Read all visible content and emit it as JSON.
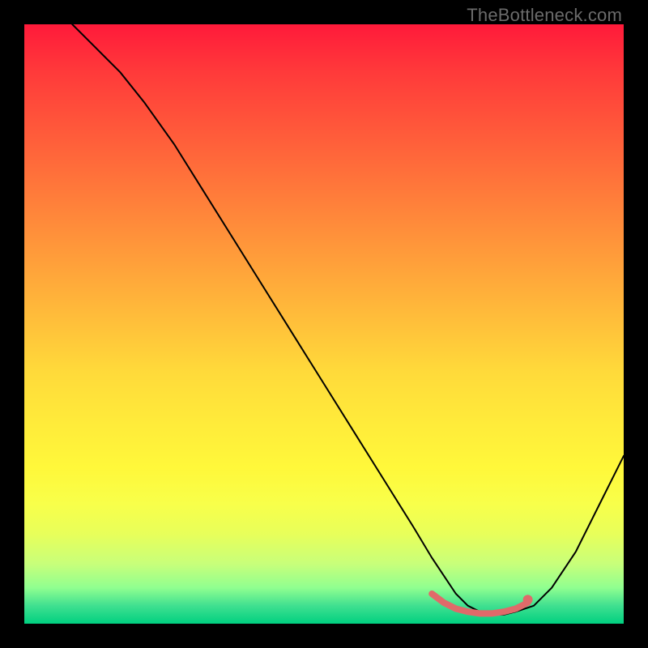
{
  "watermark": {
    "text": "TheBottleneck.com"
  },
  "chart_data": {
    "type": "line",
    "title": "",
    "xlabel": "",
    "ylabel": "",
    "xlim": [
      0,
      100
    ],
    "ylim": [
      0,
      100
    ],
    "grid": false,
    "legend": false,
    "background_gradient": {
      "top": "#ff1a3a",
      "middle": "#ffda3a",
      "bottom": "#00d080"
    },
    "series": [
      {
        "name": "curve",
        "color": "#000000",
        "stroke_width": 2,
        "x": [
          8,
          12,
          16,
          20,
          25,
          30,
          35,
          40,
          45,
          50,
          55,
          60,
          65,
          68,
          70,
          72,
          74,
          76,
          78,
          80,
          82,
          85,
          88,
          92,
          96,
          100
        ],
        "y": [
          100,
          96,
          92,
          87,
          80,
          72,
          64,
          56,
          48,
          40,
          32,
          24,
          16,
          11,
          8,
          5,
          3,
          2,
          1.5,
          1.5,
          2,
          3,
          6,
          12,
          20,
          28
        ]
      },
      {
        "name": "minimum-band",
        "color": "#e06a6a",
        "stroke_width": 8,
        "x": [
          68,
          70,
          72,
          74,
          76,
          78,
          80,
          82,
          84
        ],
        "y": [
          5,
          3.5,
          2.5,
          2,
          1.7,
          1.7,
          2,
          2.5,
          3.5
        ]
      }
    ],
    "points": [
      {
        "name": "marker-dot",
        "x": 84,
        "y": 4,
        "color": "#e06a6a",
        "radius": 6
      }
    ]
  }
}
